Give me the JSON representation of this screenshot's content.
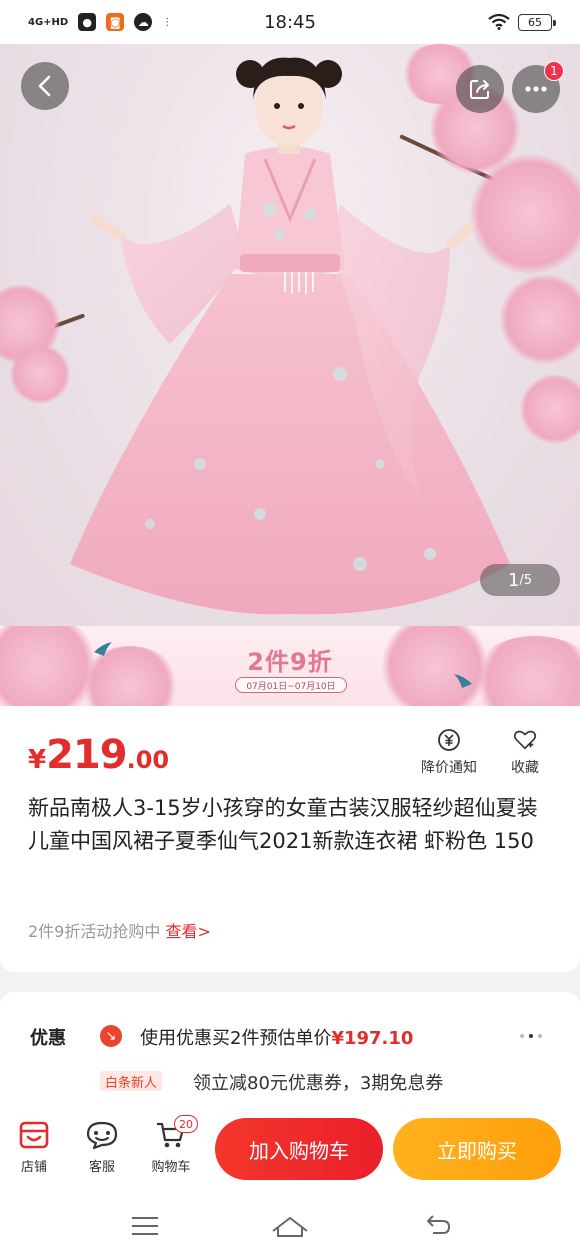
{
  "status_bar": {
    "signal": "4G+HD",
    "time": "18:45",
    "battery": "65",
    "colors": {
      "app1": "#222222",
      "app2": "#f26a1b",
      "app3": "#222222"
    }
  },
  "hero": {
    "pager_current": "1",
    "pager_total": "/5",
    "more_badge": "1",
    "icons": {
      "back": "chevron-left-icon",
      "share": "share-icon",
      "more": "more-icon"
    }
  },
  "promo": {
    "title": "2件9折",
    "date": "07月01日~07月10日"
  },
  "product": {
    "price_currency": "¥",
    "price_int": "219",
    "price_dec": ".00",
    "price_alert_label": "降价通知",
    "favorite_label": "收藏",
    "title": "新品南极人3-15岁小孩穿的女童古装汉服轻纱超仙夏装儿童中国风裙子夏季仙气2021新款连衣裙 虾粉色 150",
    "activity_text": "2件9折活动抢购中",
    "activity_link": "查看>"
  },
  "discount": {
    "label": "优惠",
    "text_prefix": "使用优惠买2件预估单价",
    "text_price": "¥197.10",
    "tag": "白条新人",
    "tag_text": "领立减80元优惠券，3期免息券"
  },
  "bottom_bar": {
    "shop_label": "店铺",
    "service_label": "客服",
    "cart_label": "购物车",
    "cart_count": "20",
    "add_cart_label": "加入购物车",
    "buy_now_label": "立即购买"
  },
  "colors": {
    "price_red": "#e32d2d",
    "cart_button": "#ea1f2b",
    "buy_button": "#ffa514",
    "promo_pink": "#e27792"
  }
}
